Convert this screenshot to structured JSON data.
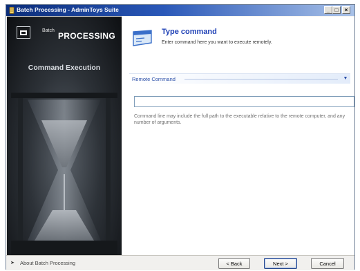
{
  "window": {
    "title": "Batch Processing - AdminToys Suite",
    "controls": {
      "minimize": "_",
      "maximize": "□",
      "close": "×"
    }
  },
  "sidebar": {
    "brand_small": "Batch",
    "brand_large": "PROCESSING",
    "heading": "Command Execution"
  },
  "header": {
    "title": "Type command",
    "subtitle": "Enter command here you want to execute remotely."
  },
  "section": {
    "label": "Remote Command",
    "expanded_icon": "chevron-down-icon"
  },
  "command": {
    "value": "",
    "hint": "Command line may include the full path to the executable relative to the remote computer, and any number of arguments."
  },
  "footer": {
    "about": "About Batch Processing",
    "back": "< Back",
    "next": "Next >",
    "cancel": "Cancel"
  },
  "colors": {
    "title_bar_start": "#0b2d7a",
    "title_bar_end": "#a9c2e8",
    "header_title": "#1d3fb5",
    "section_label": "#2b4fa8"
  }
}
